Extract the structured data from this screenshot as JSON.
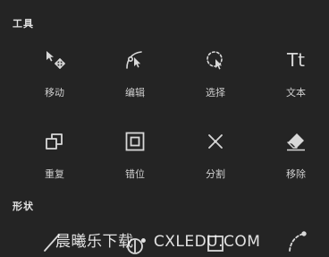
{
  "tools_section": {
    "title": "工具",
    "items": [
      {
        "label": "移动",
        "icon": "move-icon"
      },
      {
        "label": "编辑",
        "icon": "edit-path-icon"
      },
      {
        "label": "选择",
        "icon": "lasso-select-icon"
      },
      {
        "label": "文本",
        "icon": "text-icon"
      },
      {
        "label": "重复",
        "icon": "duplicate-icon"
      },
      {
        "label": "错位",
        "icon": "offset-icon"
      },
      {
        "label": "分割",
        "icon": "split-icon"
      },
      {
        "label": "移除",
        "icon": "eraser-icon"
      }
    ]
  },
  "shapes_section": {
    "title": "形状",
    "items": [
      {
        "icon": "line-icon"
      },
      {
        "icon": "circle-icon"
      },
      {
        "icon": "square-icon"
      },
      {
        "icon": "arc-icon"
      }
    ]
  },
  "text_icon_glyph": "Tt",
  "watermark": "晨曦乐下载 • CXLEDU.COM"
}
